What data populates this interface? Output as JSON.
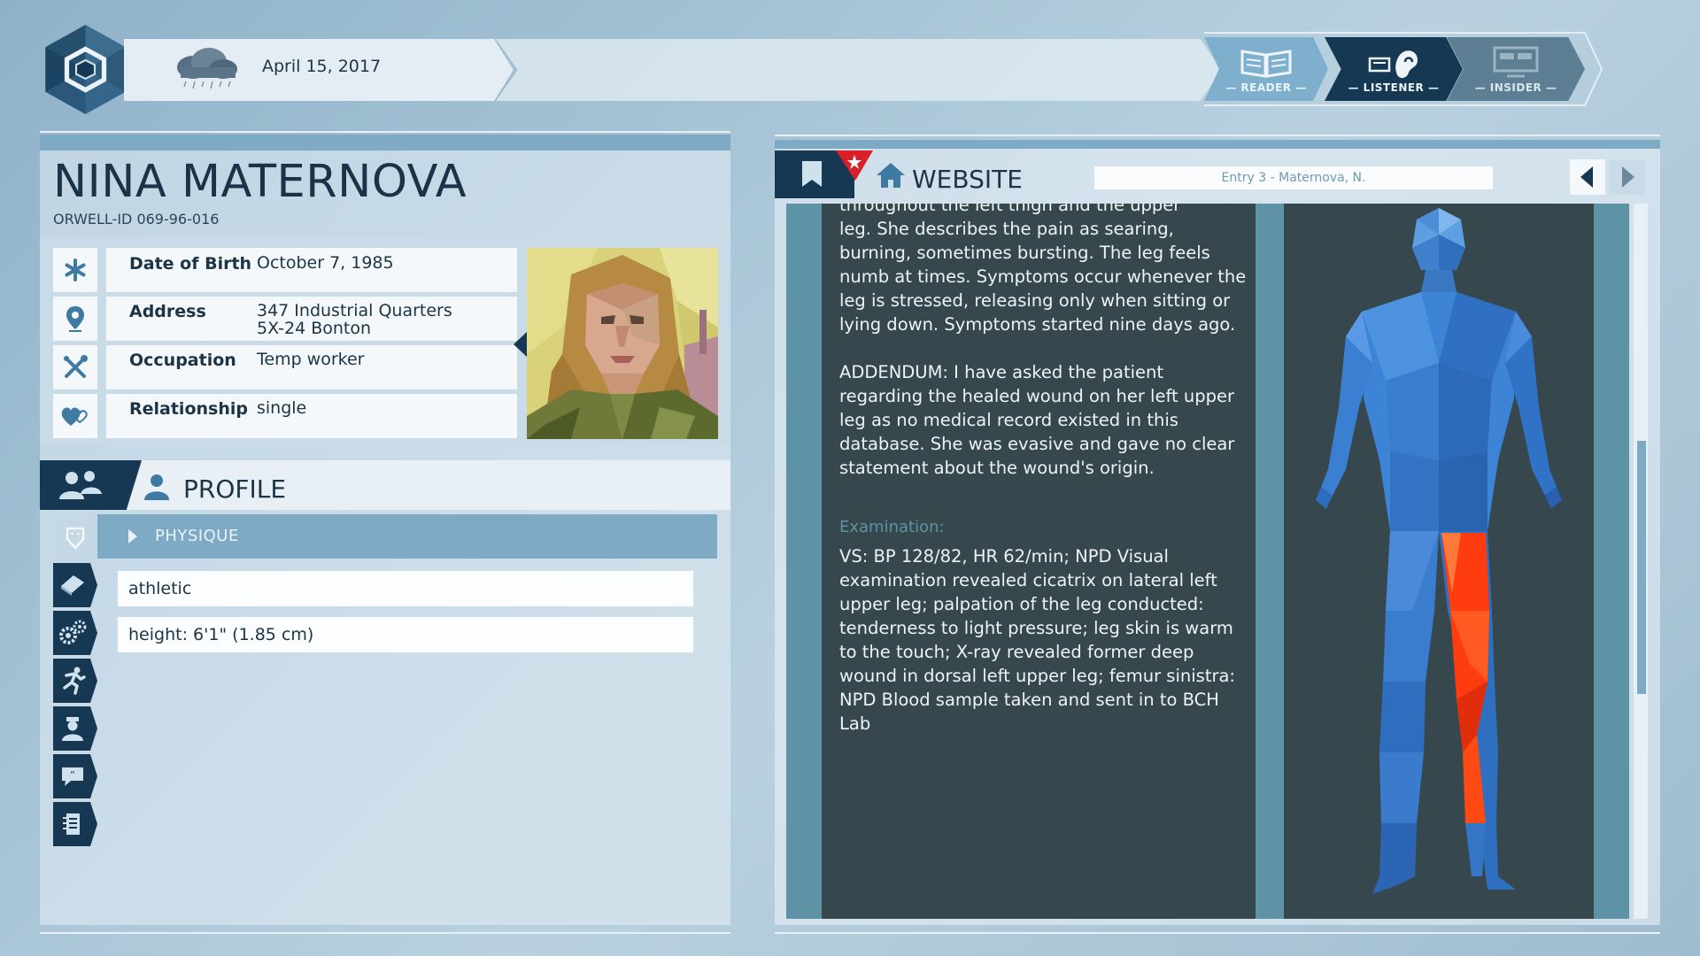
{
  "header": {
    "date": "April 15, 2017",
    "weather_icon": "rain-cloud-icon",
    "modes": [
      {
        "label": "— READER —",
        "icon": "book-icon"
      },
      {
        "label": "— LISTENER —",
        "icon": "ear-icon"
      },
      {
        "label": "— INSIDER —",
        "icon": "monitor-icon"
      }
    ]
  },
  "person": {
    "name": "NINA MATERNOVA",
    "orwell_id": "ORWELL-ID  069-96-016",
    "fields": [
      {
        "label": "Date of Birth",
        "value": "October 7, 1985",
        "icon": "asterisk-icon"
      },
      {
        "label": "Address",
        "value_line1": "347 Industrial Quarters",
        "value_line2": "5X-24 Bonton",
        "icon": "location-pin-icon"
      },
      {
        "label": "Occupation",
        "value": "Temp worker",
        "icon": "tools-icon"
      },
      {
        "label": "Relationship",
        "value": "single",
        "icon": "hearts-icon"
      }
    ]
  },
  "profile": {
    "title": "PROFILE",
    "section": "PHYSIQUE",
    "traits": [
      "athletic",
      "height: 6'1\" (1.85 cm)"
    ]
  },
  "website": {
    "title": "WEBSITE",
    "entry": "Entry 3 - Maternova, N.",
    "text_cut": "throughout the left thigh and the upper",
    "paragraph1": "leg. She describes the pain as searing, burning, sometimes bursting. The leg feels numb at times. Symptoms occur whenever the leg is stressed, releasing only when sitting or lying down. Symptoms started nine days ago.",
    "paragraph2": "ADDENDUM: I have asked the patient regarding the healed wound on her left upper leg as no medical record existed in this database. She was evasive and gave no clear statement about the wound's origin.",
    "exam_heading": "Examination:",
    "exam_text": "VS: BP 128/82, HR 62/min; NPD Visual examination revealed cicatrix on lateral left upper leg; palpation of the leg conducted: tenderness to light pressure; leg skin is warm to the touch; X-ray revealed former deep wound in dorsal left upper leg; femur sinistra: NPD Blood sample taken and sent in to BCH Lab"
  },
  "colors": {
    "navy": "#173852",
    "accent": "#7eaac6",
    "panel_dark": "#36474e",
    "injury": "#ff3b10"
  }
}
